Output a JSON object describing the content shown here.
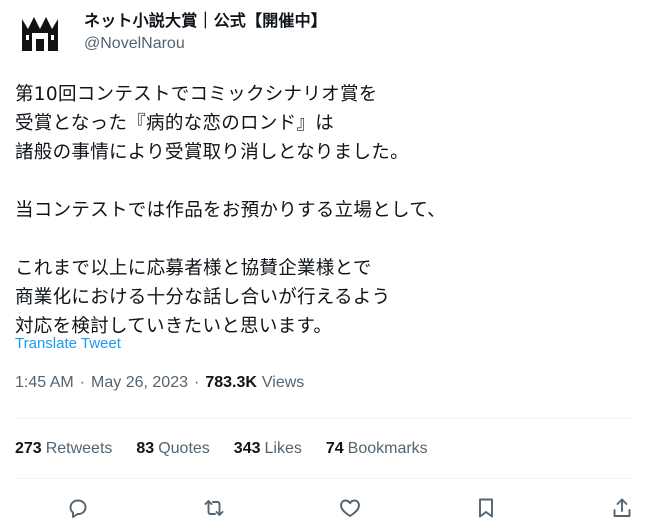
{
  "author": {
    "display_name": "ネット小説大賞｜公式【開催中】",
    "handle": "@NovelNarou",
    "avatar_icon": "crown-castle-logo"
  },
  "tweet": {
    "text": "第10回コンテストでコミックシナリオ賞を\n受賞となった『病的な恋のロンド』は\n諸般の事情により受賞取り消しとなりました。\n\n当コンテストでは作品をお預かりする立場として、\n\nこれまで以上に応募者様と協賛企業様とで\n商業化における十分な話し合いが行えるよう\n対応を検討していきたいと思います。",
    "translate_label": "Translate Tweet"
  },
  "meta": {
    "time": "1:45 AM",
    "separator": "·",
    "date": "May 26, 2023",
    "views_count": "783.3K",
    "views_label": "Views"
  },
  "stats": {
    "retweets_count": "273",
    "retweets_label": "Retweets",
    "quotes_count": "83",
    "quotes_label": "Quotes",
    "likes_count": "343",
    "likes_label": "Likes",
    "bookmarks_count": "74",
    "bookmarks_label": "Bookmarks"
  },
  "actions": [
    "reply-icon",
    "retweet-icon",
    "like-icon",
    "bookmark-icon",
    "share-icon"
  ],
  "colors": {
    "text": "#0f1419",
    "secondary": "#536471",
    "link": "#1d9bf0",
    "divider": "#eff3f4"
  }
}
